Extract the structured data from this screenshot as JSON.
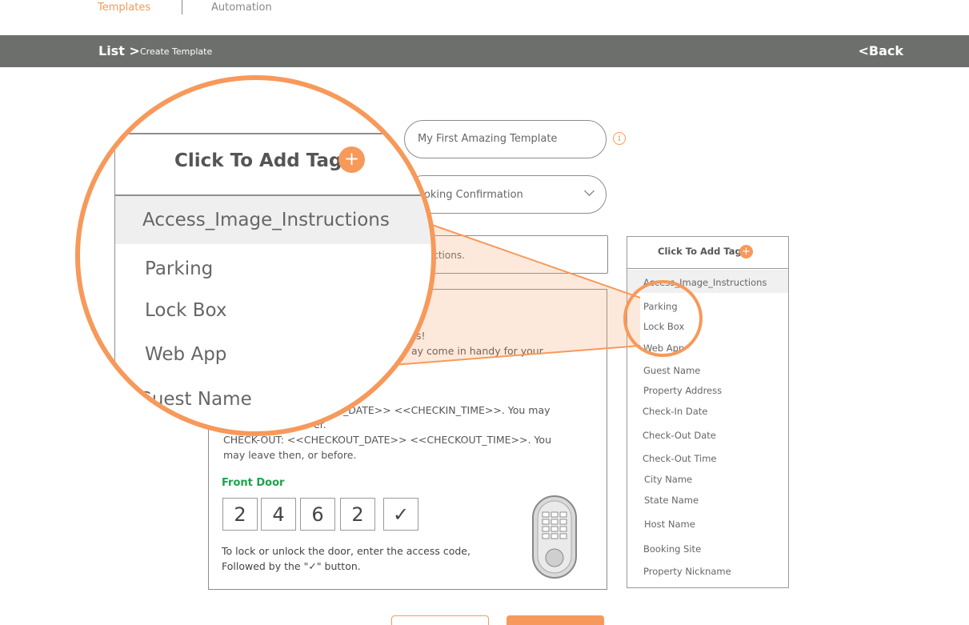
{
  "tabs": {
    "templates": "Templates",
    "automation": "Automation"
  },
  "header": {
    "list": "List >",
    "page": "Create Template",
    "back": "<Back"
  },
  "form": {
    "template_name": "My First Amazing Template",
    "message_type": "ooking Confirmation",
    "subject": "tructions."
  },
  "editor": {
    "line_a": "s!",
    "line_b": "ay come in handy for your",
    "checkin_line": "_DATE>>  <<CHECKIN_TIME>>. You may",
    "checkin_line2": "er.",
    "checkout_line": "CHECK-OUT: <<CHECKOUT_DATE>>  <<CHECKOUT_TIME>>. You",
    "checkout_line2": "may leave then, or before.",
    "front_door": "Front Door",
    "code_digits": [
      "2",
      "4",
      "6",
      "2",
      "✓"
    ],
    "lock_note_1": "To lock or unlock the door, enter the access code,",
    "lock_note_2": "Followed by the \"✓\" button."
  },
  "tag_panel": {
    "title": "Click To Add Tag",
    "plus": "+",
    "items": [
      "Access_Image_Instructions",
      "Parking",
      "Lock Box",
      "Web App",
      "Guest Name",
      "Property Address",
      "Check-In Date",
      "Check-Out Date",
      "Check-Out Time",
      "City Name",
      "State Name",
      "Host Name",
      "Booking Site",
      "Property Nickname"
    ]
  },
  "magnifier": {
    "title": "Click To Add Tag",
    "plus": "+",
    "items": [
      "Access_Image_Instructions",
      "Parking",
      "Lock Box",
      "Web App",
      "Guest Name"
    ]
  },
  "colors": {
    "accent": "#f7995a",
    "bar": "#6d6f6d",
    "success": "#1aa34a"
  },
  "icons": {
    "info": "info-circle-icon",
    "chevron": "chevron-down-icon",
    "lock": "smart-lock-keypad-icon"
  }
}
